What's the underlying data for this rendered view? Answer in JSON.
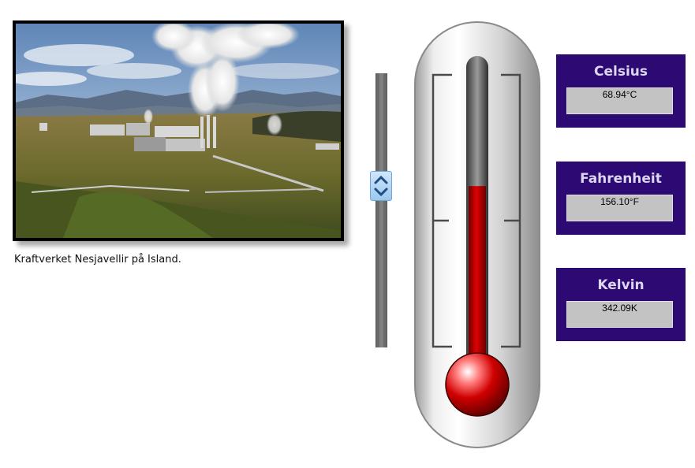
{
  "photo": {
    "caption": "Kraftverket Nesjavellir på Island."
  },
  "slider": {
    "level_percent": 60.05
  },
  "thermometer": {
    "fill_fraction": 0.6
  },
  "readouts": [
    {
      "title": "Celsius",
      "value": "68.94°C"
    },
    {
      "title": "Fahrenheit",
      "value": "156.10°F"
    },
    {
      "title": "Kelvin",
      "value": "342.09K"
    }
  ],
  "colors": {
    "panel": "#2d0a73",
    "panel_title": "#ddd6f0",
    "mercury": "#cc0000",
    "field": "#c3c3c3"
  },
  "icons": {
    "slider_thumb": "chevron-up-down-icon"
  }
}
